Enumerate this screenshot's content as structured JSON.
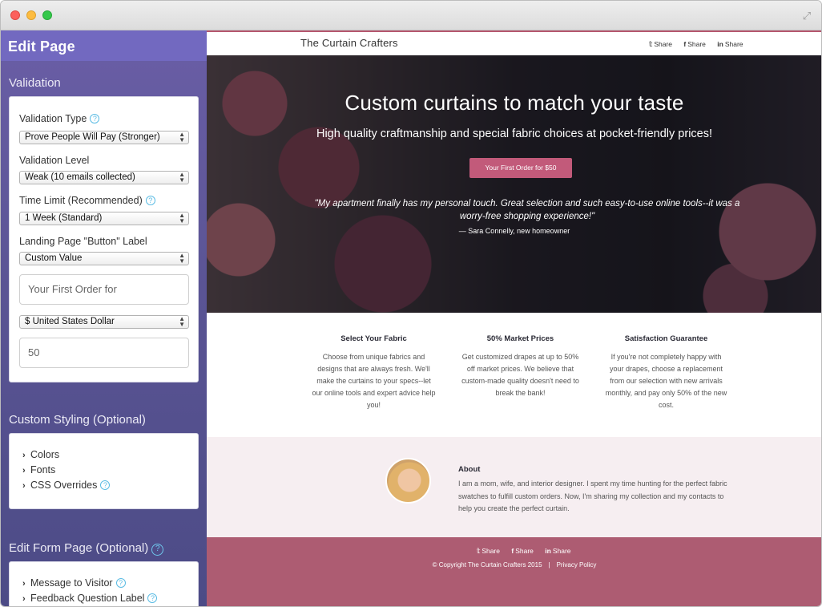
{
  "sidebar": {
    "title": "Edit Page",
    "validation": {
      "section_title": "Validation",
      "type_label": "Validation Type",
      "type_value": "Prove People Will Pay (Stronger)",
      "level_label": "Validation Level",
      "level_value": "Weak (10 emails collected)",
      "time_label": "Time Limit (Recommended)",
      "time_value": "1 Week (Standard)",
      "button_label_label": "Landing Page \"Button\" Label",
      "button_label_value": "Custom Value",
      "custom_text_value": "Your First Order for",
      "currency_value": "$ United States Dollar",
      "amount_value": "50"
    },
    "styling": {
      "section_title": "Custom Styling (Optional)",
      "items": [
        "Colors",
        "Fonts",
        "CSS Overrides"
      ]
    },
    "form_page": {
      "section_title": "Edit Form Page (Optional)",
      "items": [
        "Message to Visitor",
        "Feedback Question Label"
      ]
    },
    "help_glyph": "?"
  },
  "site": {
    "brand": "The Curtain Crafters",
    "share": [
      "Share",
      "Share",
      "Share"
    ],
    "hero": {
      "title": "Custom curtains to match your taste",
      "subtitle": "High quality craftmanship and special fabric choices at pocket-friendly prices!",
      "button": "Your First Order for $50",
      "quote": "\"My apartment finally has my personal touch. Great selection and such easy-to-use online tools--it was a worry-free shopping experience!\"",
      "author": "— Sara Connelly, new homeowner"
    },
    "features": [
      {
        "title": "Select Your Fabric",
        "text": "Choose from unique fabrics and designs that are always fresh. We'll make the curtains to your specs--let our online tools and expert advice help you!"
      },
      {
        "title": "50% Market Prices",
        "text": "Get customized drapes at up to 50% off market prices. We believe that custom-made quality doesn't need to break the bank!"
      },
      {
        "title": "Satisfaction Guarantee",
        "text": "If you're not completely happy with your drapes, choose a replacement from our selection with new arrivals monthly, and pay only 50% of the new cost."
      }
    ],
    "about": {
      "title": "About",
      "text": "I am a mom, wife, and interior designer. I spent my time hunting for the perfect fabric swatches to fulfill custom orders. Now, I'm sharing my collection and my contacts to help you create the perfect curtain."
    },
    "footer": {
      "copyright": "© Copyright The Curtain Crafters 2015",
      "separator": "|",
      "privacy": "Privacy Policy"
    }
  },
  "colors": {
    "sidebar_header": "#7269c0",
    "sidebar_bg": "#5a5494",
    "accent_pink": "#c25a7a",
    "footer": "#ad5c72",
    "about_bg": "#f6eef1",
    "help_icon": "#5bbce4"
  }
}
